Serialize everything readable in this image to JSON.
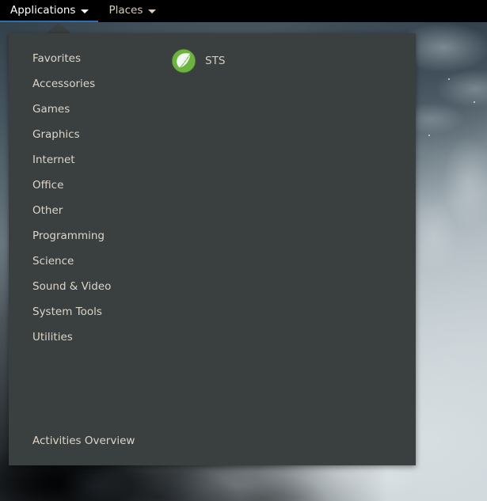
{
  "panel": {
    "menus": [
      {
        "label": "Applications",
        "icon": "chevron-down-icon",
        "active": true
      },
      {
        "label": "Places",
        "icon": "chevron-down-icon",
        "active": false
      }
    ]
  },
  "menu": {
    "categories": [
      {
        "label": "Favorites"
      },
      {
        "label": "Accessories"
      },
      {
        "label": "Games"
      },
      {
        "label": "Graphics"
      },
      {
        "label": "Internet"
      },
      {
        "label": "Office"
      },
      {
        "label": "Other"
      },
      {
        "label": "Programming"
      },
      {
        "label": "Science"
      },
      {
        "label": "Sound & Video"
      },
      {
        "label": "System Tools"
      },
      {
        "label": "Utilities"
      }
    ],
    "overview_label": "Activities Overview",
    "applications": [
      {
        "label": "STS",
        "icon": "spring-sts-icon"
      }
    ]
  },
  "colors": {
    "panel_background": "#000000",
    "menu_background": "#3a3f3f",
    "menu_text": "#ddd5c8",
    "active_menu_text": "#ffffff",
    "active_underline": "#2f6fae",
    "sts_icon_green": "#6db33f",
    "sts_icon_leaf": "#f2f6f0"
  }
}
